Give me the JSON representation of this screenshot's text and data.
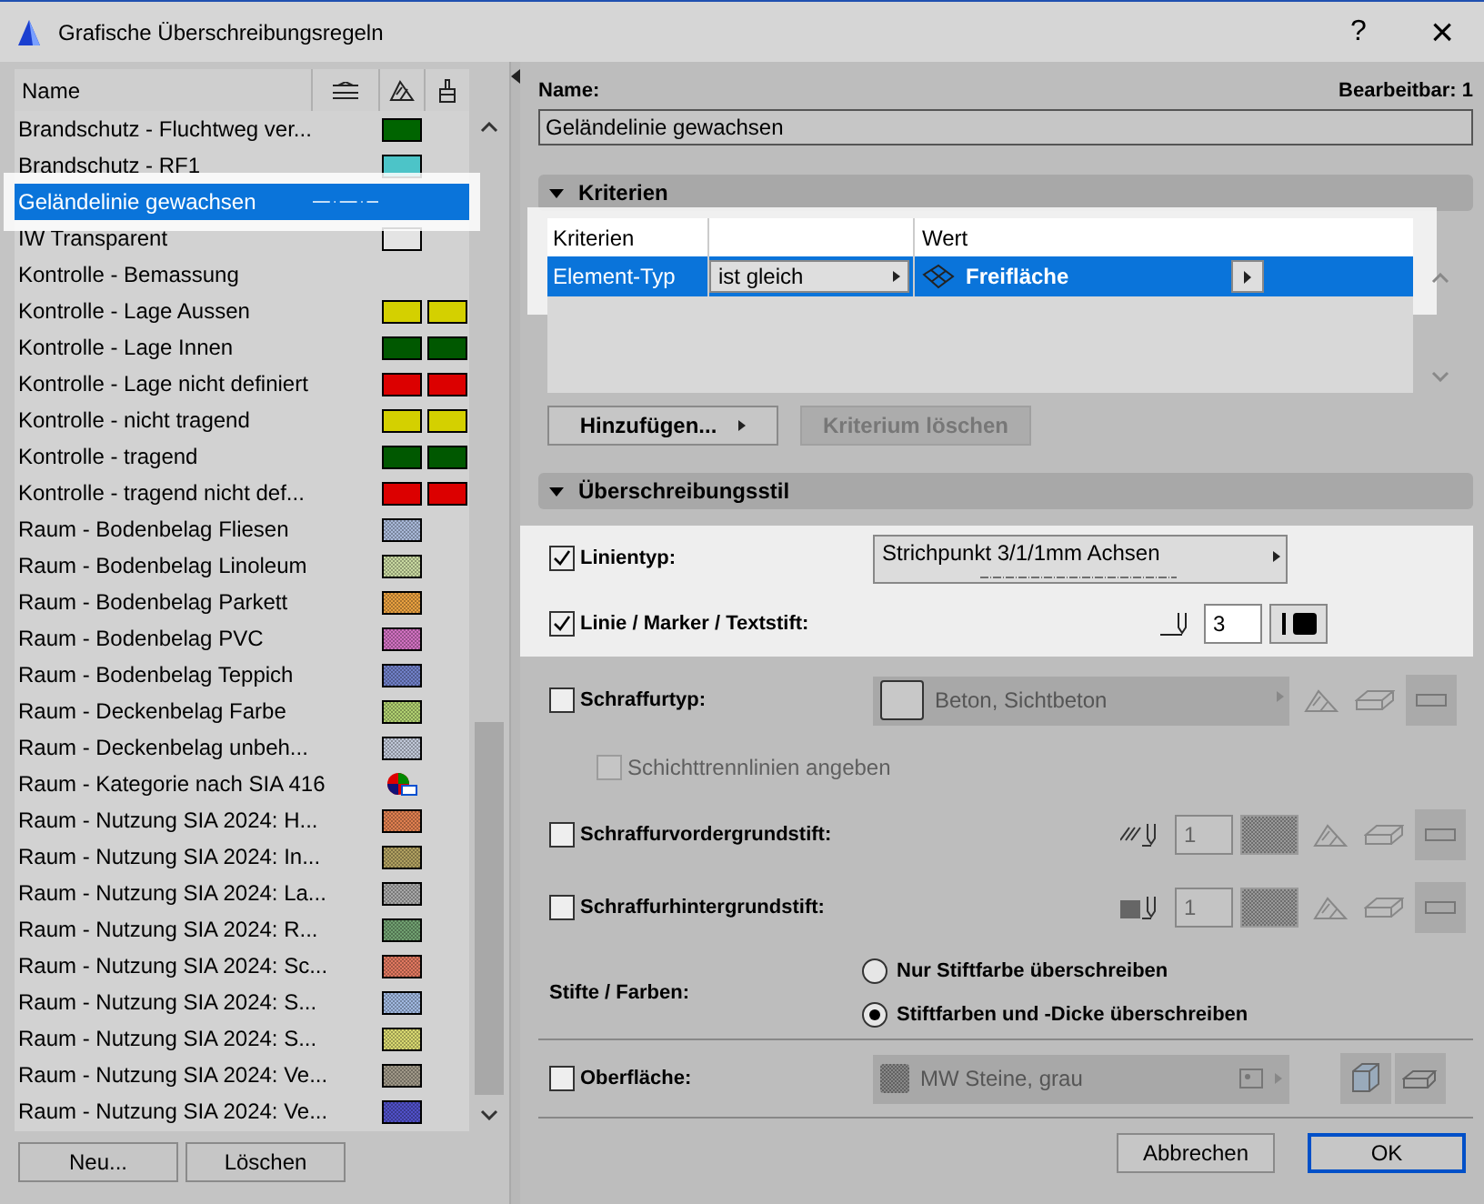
{
  "window": {
    "title": "Grafische Überschreibungsregeln",
    "help": "?",
    "close": "×"
  },
  "list": {
    "column_name": "Name",
    "items": [
      {
        "name": "Brandschutz - Fluchtweg ver...",
        "selected": false,
        "highlighted": false,
        "kind": "solid",
        "swatches": [
          {
            "color": "#006400"
          }
        ]
      },
      {
        "name": "Brandschutz - RF1",
        "selected": false,
        "highlighted": false,
        "kind": "solid",
        "swatches": [
          {
            "color": "#4cc4c8"
          }
        ]
      },
      {
        "name": "Geländelinie gewachsen",
        "selected": true,
        "highlighted": true,
        "kind": "line"
      },
      {
        "name": "IW Transparent",
        "selected": false,
        "highlighted": false,
        "kind": "solid",
        "swatches": [
          {
            "color": "#e4e4e4"
          }
        ]
      },
      {
        "name": "Kontrolle - Bemassung",
        "selected": false,
        "highlighted": false,
        "kind": "none"
      },
      {
        "name": "Kontrolle - Lage Aussen",
        "selected": false,
        "highlighted": false,
        "kind": "solid",
        "swatches": [
          {
            "color": "#d4d000"
          },
          {
            "color": "#d4d000"
          }
        ]
      },
      {
        "name": "Kontrolle - Lage Innen",
        "selected": false,
        "highlighted": false,
        "kind": "solid",
        "swatches": [
          {
            "color": "#005800"
          },
          {
            "color": "#005800"
          }
        ]
      },
      {
        "name": "Kontrolle - Lage nicht definiert",
        "selected": false,
        "highlighted": false,
        "kind": "solid",
        "swatches": [
          {
            "color": "#dc0000"
          },
          {
            "color": "#dc0000"
          }
        ]
      },
      {
        "name": "Kontrolle - nicht tragend",
        "selected": false,
        "highlighted": false,
        "kind": "solid",
        "swatches": [
          {
            "color": "#d4d000"
          },
          {
            "color": "#d4d000"
          }
        ]
      },
      {
        "name": "Kontrolle - tragend",
        "selected": false,
        "highlighted": false,
        "kind": "solid",
        "swatches": [
          {
            "color": "#005800"
          },
          {
            "color": "#005800"
          }
        ]
      },
      {
        "name": "Kontrolle - tragend nicht def...",
        "selected": false,
        "highlighted": false,
        "kind": "solid",
        "swatches": [
          {
            "color": "#dc0000"
          },
          {
            "color": "#dc0000"
          }
        ]
      },
      {
        "name": "Raum - Bodenbelag Fliesen",
        "selected": false,
        "highlighted": false,
        "kind": "pattern",
        "swatches": [
          {
            "color": "#a8b8d8"
          }
        ]
      },
      {
        "name": "Raum - Bodenbelag Linoleum",
        "selected": false,
        "highlighted": false,
        "kind": "pattern",
        "swatches": [
          {
            "color": "#c8d8a0"
          }
        ]
      },
      {
        "name": "Raum - Bodenbelag Parkett",
        "selected": false,
        "highlighted": false,
        "kind": "pattern",
        "swatches": [
          {
            "color": "#e8a040"
          }
        ]
      },
      {
        "name": "Raum - Bodenbelag PVC",
        "selected": false,
        "highlighted": false,
        "kind": "pattern",
        "swatches": [
          {
            "color": "#d070c0"
          }
        ]
      },
      {
        "name": "Raum - Bodenbelag Teppich",
        "selected": false,
        "highlighted": false,
        "kind": "pattern",
        "swatches": [
          {
            "color": "#7080c8"
          }
        ]
      },
      {
        "name": "Raum - Deckenbelag Farbe",
        "selected": false,
        "highlighted": false,
        "kind": "pattern",
        "swatches": [
          {
            "color": "#b0d070"
          }
        ]
      },
      {
        "name": "Raum - Deckenbelag unbeh...",
        "selected": false,
        "highlighted": false,
        "kind": "pattern",
        "swatches": [
          {
            "color": "#c0c8d8"
          }
        ]
      },
      {
        "name": "Raum - Kategorie nach SIA 416",
        "selected": false,
        "highlighted": false,
        "kind": "icon"
      },
      {
        "name": "Raum - Nutzung SIA 2024: H...",
        "selected": false,
        "highlighted": false,
        "kind": "pattern",
        "swatches": [
          {
            "color": "#e08050"
          }
        ]
      },
      {
        "name": "Raum - Nutzung SIA 2024: In...",
        "selected": false,
        "highlighted": false,
        "kind": "pattern",
        "swatches": [
          {
            "color": "#b0a060"
          }
        ]
      },
      {
        "name": "Raum - Nutzung SIA 2024: La...",
        "selected": false,
        "highlighted": false,
        "kind": "pattern",
        "swatches": [
          {
            "color": "#a8a8a8"
          }
        ]
      },
      {
        "name": "Raum - Nutzung SIA 2024: R...",
        "selected": false,
        "highlighted": false,
        "kind": "pattern",
        "swatches": [
          {
            "color": "#70a070"
          }
        ]
      },
      {
        "name": "Raum - Nutzung SIA 2024: Sc...",
        "selected": false,
        "highlighted": false,
        "kind": "pattern",
        "swatches": [
          {
            "color": "#e07860"
          }
        ]
      },
      {
        "name": "Raum - Nutzung SIA 2024: S...",
        "selected": false,
        "highlighted": false,
        "kind": "pattern",
        "swatches": [
          {
            "color": "#a0b8e0"
          }
        ]
      },
      {
        "name": "Raum - Nutzung SIA 2024: S...",
        "selected": false,
        "highlighted": false,
        "kind": "pattern",
        "swatches": [
          {
            "color": "#d8d870"
          }
        ]
      },
      {
        "name": "Raum - Nutzung SIA 2024: Ve...",
        "selected": false,
        "highlighted": false,
        "kind": "pattern",
        "swatches": [
          {
            "color": "#a09888"
          }
        ]
      },
      {
        "name": "Raum - Nutzung SIA 2024: Ve...",
        "selected": false,
        "highlighted": false,
        "kind": "pattern",
        "swatches": [
          {
            "color": "#5050c8"
          }
        ]
      }
    ],
    "buttons": [
      "Neu...",
      "Löschen"
    ]
  },
  "detail": {
    "name_label": "Name:",
    "editable": "Bearbeitbar: 1",
    "name_value": "Geländelinie gewachsen",
    "criteria": {
      "title": "Kriterien",
      "expanded": true,
      "highlighted": true,
      "columns": [
        "Kriterien",
        "Wert"
      ],
      "rows": [
        {
          "criterion": "Element-Typ",
          "operator": "ist gleich",
          "value": "Freifläche",
          "selected": true
        }
      ],
      "add_button": "Hinzufügen...",
      "delete_button": {
        "label": "Kriterium löschen",
        "disabled": true
      }
    },
    "style": {
      "title": "Überschreibungsstil",
      "expanded": true,
      "rows": [
        {
          "kind": "linetype",
          "label": "Linientyp:",
          "checked": true,
          "disabled": false,
          "highlighted": true,
          "value": "Strichpunkt 3/1/1mm Achsen"
        },
        {
          "kind": "pen",
          "label": "Linie / Marker / Textstift:",
          "checked": true,
          "disabled": false,
          "highlighted": true,
          "value": "3"
        },
        {
          "kind": "fill",
          "label": "Schraffurtyp:",
          "checked": false,
          "disabled": false,
          "highlighted": false,
          "value": "Beton, Sichtbeton"
        },
        {
          "kind": "sub",
          "label": "Schichttrennlinien angeben",
          "checked": false,
          "disabled": true,
          "highlighted": false
        },
        {
          "kind": "fgpen",
          "label": "Schraffurvordergrundstift:",
          "checked": false,
          "disabled": false,
          "highlighted": false,
          "value": "1"
        },
        {
          "kind": "bgpen",
          "label": "Schraffurhintergrundstift:",
          "checked": false,
          "disabled": false,
          "highlighted": false,
          "value": "1"
        }
      ]
    },
    "pens": {
      "label": "Stifte / Farben:",
      "options": [
        {
          "label": "Nur Stiftfarbe überschreiben",
          "selected": false
        },
        {
          "label": "Stiftfarben und -Dicke überschreiben",
          "selected": true
        }
      ]
    },
    "surface": {
      "label": "Oberfläche:",
      "checked": false,
      "value": "MW Steine, grau"
    }
  },
  "footer": {
    "cancel": "Abbrechen",
    "ok": "OK"
  }
}
